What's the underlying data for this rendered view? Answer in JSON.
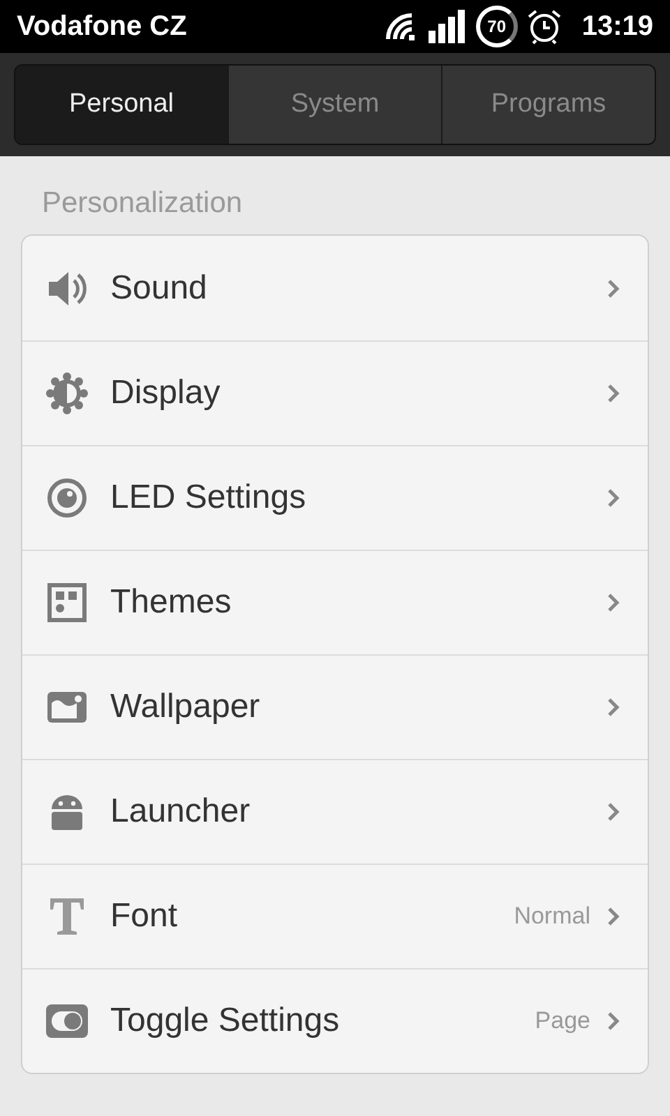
{
  "status_bar": {
    "carrier": "Vodafone CZ",
    "battery": "70",
    "time": "13:19"
  },
  "tabs": [
    {
      "label": "Personal",
      "selected": true
    },
    {
      "label": "System",
      "selected": false
    },
    {
      "label": "Programs",
      "selected": false
    }
  ],
  "section": {
    "title": "Personalization"
  },
  "items": [
    {
      "label": "Sound"
    },
    {
      "label": "Display"
    },
    {
      "label": "LED Settings"
    },
    {
      "label": "Themes"
    },
    {
      "label": "Wallpaper"
    },
    {
      "label": "Launcher"
    },
    {
      "label": "Font",
      "value": "Normal"
    },
    {
      "label": "Toggle Settings",
      "value": "Page"
    }
  ]
}
